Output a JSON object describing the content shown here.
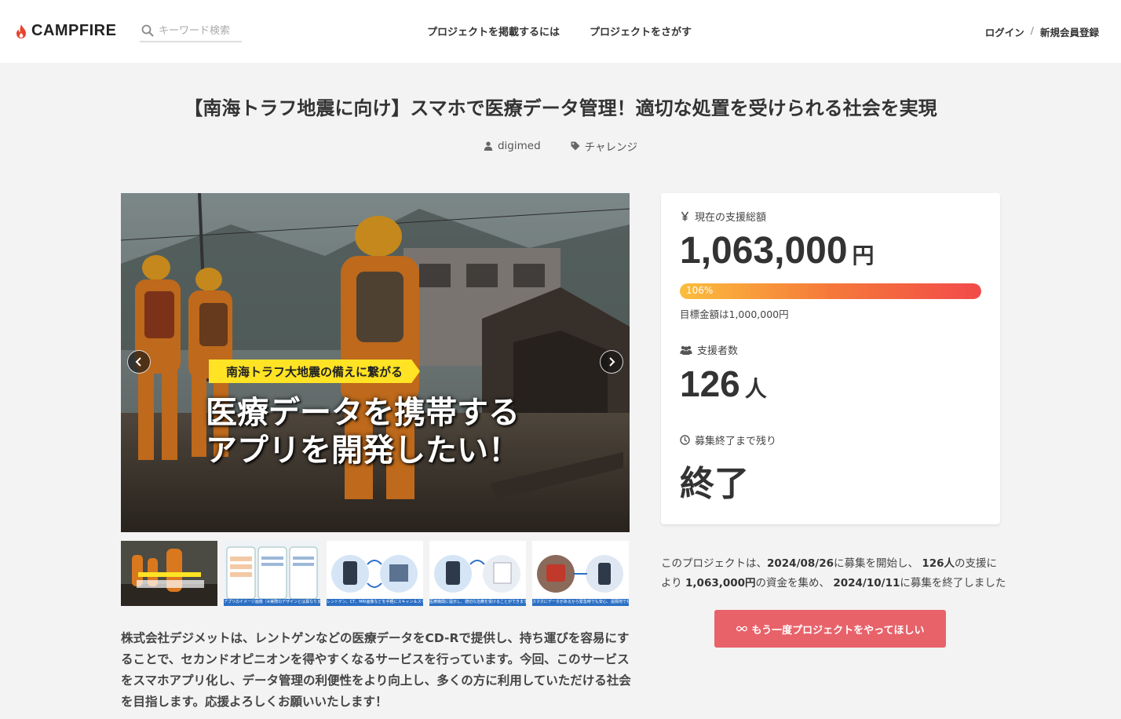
{
  "header": {
    "logo_text": "CAMPFIRE",
    "search_placeholder": "キーワード検索",
    "nav_post": "プロジェクトを掲載するには",
    "nav_find": "プロジェクトをさがす",
    "login": "ログイン",
    "separator": "/",
    "register": "新規会員登録"
  },
  "project": {
    "title": "【南海トラフ地震に向け】スマホで医療データ管理！適切な処置を受けられる社会を実現",
    "owner": "digimed",
    "category": "チャレンジ"
  },
  "hero": {
    "banner": "南海トラフ大地震の備えに繋がる",
    "headline_1": "医療データを携帯する",
    "headline_2": "アプリを開発したい！"
  },
  "thumbs": [
    {
      "caption": ""
    },
    {
      "caption": "アプリのイメージ画像（※実際のデザインとは異なります）"
    },
    {
      "caption": "レントゲン、CT、MRI画像などを手軽にスキャン＆スマホに保存します"
    },
    {
      "caption": "医療機関に提示し、適切な治療を受けることができます"
    },
    {
      "caption": "スマホにデータがあるから緊急時でも安心、遠隔地でも受診可能です"
    }
  ],
  "description": "株式会社デジメットは、レントゲンなどの医療データをCD-Rで提供し、持ち運びを容易にすることで、セカンドオピニオンを得やすくなるサービスを行っています。今回、このサービスをスマホアプリ化し、データ管理の利便性をより向上し、多くの方に利用していただける社会を目指します。応援よろしくお願いいたします！",
  "stats": {
    "total_label": "現在の支援総額",
    "total_value": "1,063,000",
    "total_unit": "円",
    "progress_percent": 106,
    "progress_label": "106%",
    "goal_text": "目標金額は1,000,000円",
    "backers_label": "支援者数",
    "backers_value": "126",
    "backers_unit": "人",
    "remaining_label": "募集終了まで残り",
    "remaining_value": "終了"
  },
  "summary": {
    "p1": "このプロジェクトは、",
    "start_date": "2024/08/26",
    "p2": "に募集を開始し、",
    "backers": "126人",
    "p3": "の支援により",
    "amount": "1,063,000円",
    "p4": "の資金を集め、",
    "end_date": "2024/10/11",
    "p5": "に募集を終了しました"
  },
  "again_button": "もう一度プロジェクトをやってほしい",
  "colors": {
    "accent": "#e8626a",
    "banner": "#ffe324",
    "thumb_caption": "#2b6fc4"
  }
}
